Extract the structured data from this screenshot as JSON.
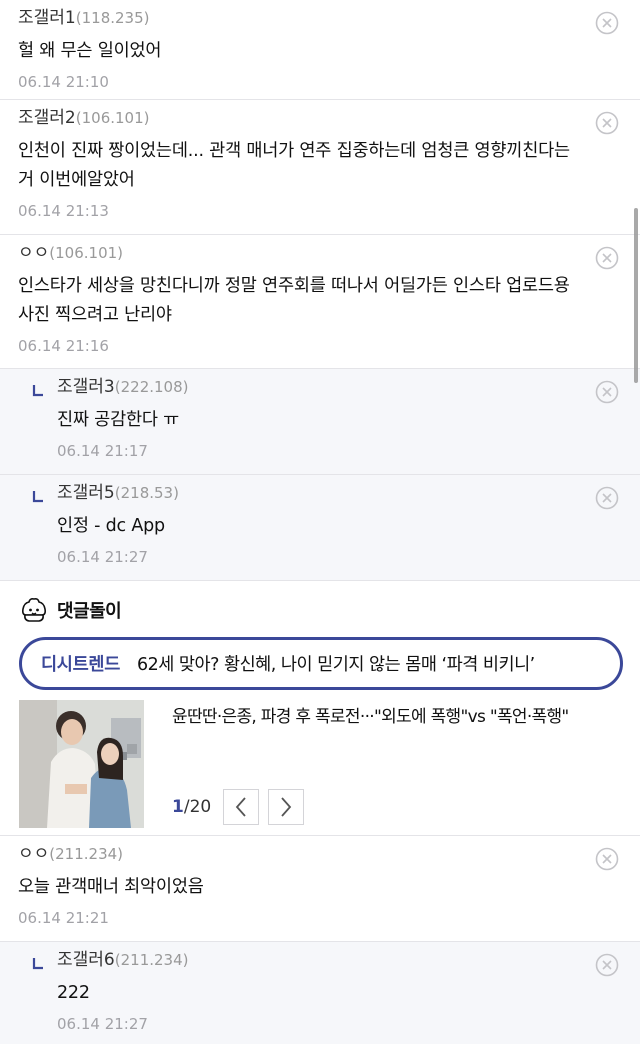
{
  "comments_top": [
    {
      "author": "조갤러1",
      "ip": "(118.235)",
      "text": "헐 왜 무슨 일이었어",
      "date": "06.14 21:10",
      "reply": false
    },
    {
      "author": "조갤러2",
      "ip": "(106.101)",
      "text": "인천이 진짜 짱이었는데... 관객 매너가 연주 집중하는데 엄청큰 영향끼친다는거 이번에알았어",
      "date": "06.14 21:13",
      "reply": false
    },
    {
      "author": "ㅇㅇ",
      "ip": "(106.101)",
      "text": "인스타가 세상을 망친다니까 정말 연주회를 떠나서 어딜가든 인스타 업로드용 사진 찍으려고 난리야",
      "date": "06.14 21:16",
      "reply": false
    },
    {
      "author": "조갤러3",
      "ip": "(222.108)",
      "text": "진짜 공감한다 ㅠ",
      "date": "06.14 21:17",
      "reply": true
    },
    {
      "author": "조갤러5",
      "ip": "(218.53)",
      "text": "인정 - dc App",
      "date": "06.14 21:27",
      "reply": true
    }
  ],
  "bot": {
    "title": "댓글돌이",
    "trend_tag": "디시트렌드",
    "trend_text": "62세 맞아? 황신혜, 나이 믿기지 않는 몸매 ‘파격 비키니’",
    "news_title": "윤딴딴·은종, 파경 후 폭로전···\"외도에 폭행\"vs \"폭언·폭행\"",
    "page_current": "1",
    "page_total": "/20"
  },
  "comments_bottom": [
    {
      "author": "ㅇㅇ",
      "ip": "(211.234)",
      "text": "오늘 관객매너 최악이었음",
      "date": "06.14 21:21",
      "reply": false
    },
    {
      "author": "조갤러6",
      "ip": "(211.234)",
      "text": "222",
      "date": "06.14 21:27",
      "reply": true
    }
  ],
  "colors": {
    "accent": "#3b4899",
    "reply_bg": "#f6f7fa",
    "date": "#a2a2a7",
    "ip": "#999999"
  },
  "icons": {
    "delete": "close-circle-icon",
    "reply": "reply-arrow-icon",
    "bot": "bot-mascot-icon",
    "prev": "chevron-left-icon",
    "next": "chevron-right-icon"
  }
}
